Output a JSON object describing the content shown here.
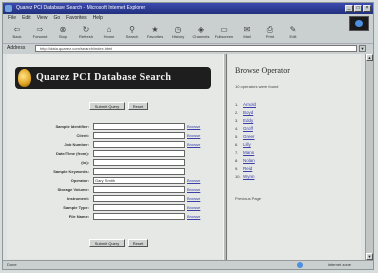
{
  "window": {
    "title": "Quarez PCI Database Search - Microsoft Internet Explorer"
  },
  "menu": [
    "File",
    "Edit",
    "View",
    "Go",
    "Favorites",
    "Help"
  ],
  "toolbar": {
    "buttons": [
      {
        "label": "Back",
        "icon": "back-arrow-icon"
      },
      {
        "label": "Forward",
        "icon": "forward-arrow-icon"
      },
      {
        "label": "Stop",
        "icon": "stop-icon"
      },
      {
        "label": "Refresh",
        "icon": "refresh-icon"
      },
      {
        "label": "Home",
        "icon": "home-icon"
      },
      {
        "label": "Search",
        "icon": "search-icon"
      },
      {
        "label": "Favorites",
        "icon": "favorites-icon"
      },
      {
        "label": "History",
        "icon": "history-icon"
      },
      {
        "label": "Channels",
        "icon": "channels-icon"
      },
      {
        "label": "Fullscreen",
        "icon": "fullscreen-icon"
      },
      {
        "label": "Mail",
        "icon": "mail-icon"
      },
      {
        "label": "Print",
        "icon": "print-icon"
      },
      {
        "label": "Edit",
        "icon": "edit-icon"
      }
    ]
  },
  "address": {
    "label": "Address",
    "url": "http://data.quarez.com/search/index.html"
  },
  "search_page": {
    "banner_title": "Quarez PCI Database Search",
    "top_buttons": [
      "Submit Query",
      "Reset"
    ],
    "fields": [
      {
        "label": "Sample Identifier:",
        "value": "",
        "browse": "Browse"
      },
      {
        "label": "Client:",
        "value": "",
        "browse": "Browse"
      },
      {
        "label": "Job Number:",
        "value": "",
        "browse": "Browse"
      },
      {
        "label": "Date/Time (from):",
        "value": "",
        "browse": ""
      },
      {
        "label": "(to):",
        "value": "",
        "browse": ""
      },
      {
        "label": "Sample Keywords:",
        "value": "",
        "browse": ""
      },
      {
        "label": "Operator:",
        "value": "Gary Smith",
        "browse": "Browse"
      },
      {
        "label": "Storage Volume:",
        "value": "",
        "browse": "Browse"
      },
      {
        "label": "Instrument:",
        "value": "",
        "browse": "Browse"
      },
      {
        "label": "Sample Type:",
        "value": "",
        "browse": "Browse"
      },
      {
        "label": "File Name:",
        "value": "",
        "browse": "Browse"
      }
    ],
    "bottom_buttons": [
      "Submit Query",
      "Reset"
    ]
  },
  "browse_panel": {
    "title": "Browse Operator",
    "subtitle": "10 operators were found",
    "operators": [
      "Arnold",
      "Boyd",
      "Eddy",
      "Groff",
      "Greer",
      "Lilly",
      "Mann",
      "Nolan",
      "Reid",
      "Wynn"
    ],
    "back_link": "Previous Page"
  },
  "status": {
    "text": "Done",
    "zone": "Internet zone"
  },
  "colors": {
    "titlebar": "#2a3a9c",
    "link": "#3b3fa8",
    "banner": "#1e1e1e"
  }
}
